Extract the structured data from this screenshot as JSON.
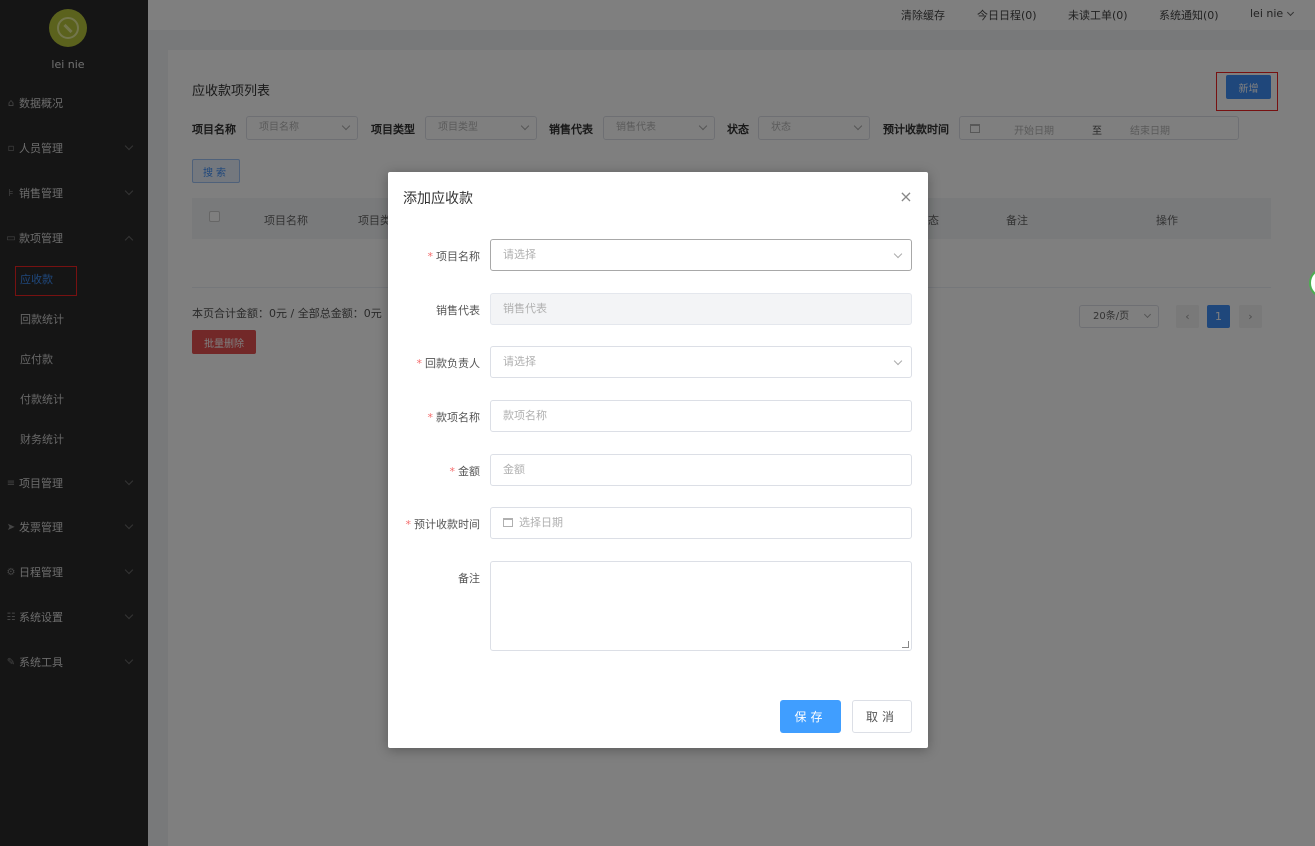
{
  "user": {
    "name": "lei nie"
  },
  "sidebar": {
    "items": [
      {
        "label": "数据概况"
      },
      {
        "label": "人员管理"
      },
      {
        "label": "销售管理"
      },
      {
        "label": "款项管理"
      },
      {
        "label": "项目管理"
      },
      {
        "label": "发票管理"
      },
      {
        "label": "日程管理"
      },
      {
        "label": "系统设置"
      },
      {
        "label": "系统工具"
      }
    ],
    "sub_items": [
      {
        "label": "应收款"
      },
      {
        "label": "回款统计"
      },
      {
        "label": "应付款"
      },
      {
        "label": "付款统计"
      },
      {
        "label": "财务统计"
      }
    ]
  },
  "topbar": {
    "clear_cache": "清除缓存",
    "today_schedule": "今日日程(0)",
    "unread_orders": "未读工单(0)",
    "notifications": "系统通知(0)",
    "user": "lei nie"
  },
  "list": {
    "title": "应收款项列表",
    "add_label": "新增",
    "filters": {
      "project_name_label": "项目名称",
      "project_name_placeholder": "项目名称",
      "project_type_label": "项目类型",
      "project_type_placeholder": "项目类型",
      "sales_rep_label": "销售代表",
      "sales_rep_placeholder": "销售代表",
      "status_label": "状态",
      "status_placeholder": "状态",
      "expected_time_label": "预计收款时间",
      "start_date": "开始日期",
      "to": "至",
      "end_date": "结束日期"
    },
    "search_label": "搜索",
    "columns": [
      "项目名称",
      "项目类",
      "态",
      "备注",
      "操作"
    ],
    "summary": "本页合计金额：0元 / 全部总金额：0元",
    "batch_delete": "批量删除",
    "page_size": "20条/页",
    "prev": "‹",
    "current_page": "1",
    "next": "›"
  },
  "modal": {
    "title": "添加应收款",
    "close": "×",
    "fields": {
      "project_name": {
        "label": "项目名称",
        "placeholder": "请选择"
      },
      "sales_rep": {
        "label": "销售代表",
        "placeholder": "销售代表"
      },
      "collector": {
        "label": "回款负责人",
        "placeholder": "请选择"
      },
      "item_name": {
        "label": "款项名称",
        "placeholder": "款项名称"
      },
      "amount": {
        "label": "金额",
        "placeholder": "金额"
      },
      "expected_date": {
        "label": "预计收款时间",
        "placeholder": "选择日期"
      },
      "remark": {
        "label": "备注"
      }
    },
    "save_label": "保存",
    "cancel_label": "取消"
  },
  "colors": {
    "primary": "#409eff",
    "danger": "#e55050",
    "sidebar_bg": "#2b2b2b",
    "highlight_border": "#ee2222"
  }
}
